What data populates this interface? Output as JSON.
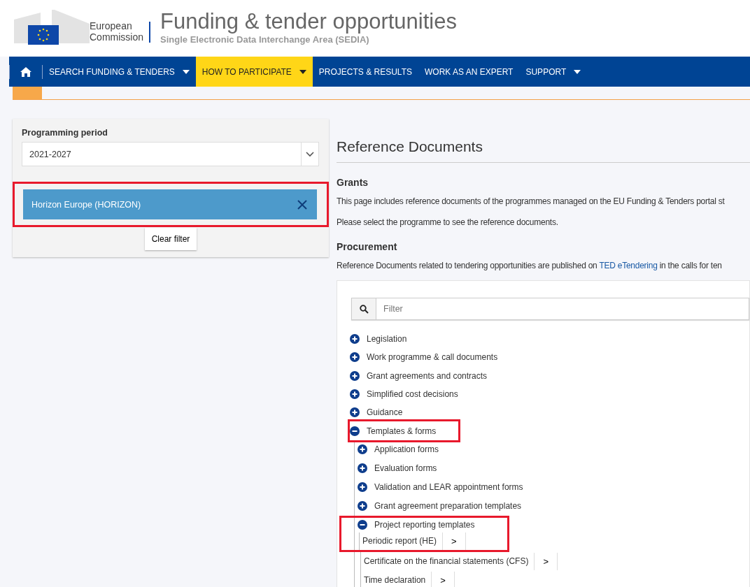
{
  "header": {
    "org_line1": "European",
    "org_line2": "Commission",
    "title": "Funding & tender opportunities",
    "subtitle": "Single Electronic Data Interchange Area (SEDIA)"
  },
  "nav": [
    {
      "label": "SEARCH FUNDING & TENDERS",
      "selected": false,
      "dropdown": true
    },
    {
      "label": "HOW TO PARTICIPATE",
      "selected": true,
      "dropdown": true
    },
    {
      "label": "PROJECTS & RESULTS",
      "selected": false,
      "dropdown": false
    },
    {
      "label": "WORK AS AN EXPERT",
      "selected": false,
      "dropdown": false
    },
    {
      "label": "SUPPORT",
      "selected": false,
      "dropdown": true
    }
  ],
  "filter_panel": {
    "label": "Programming period",
    "value": "2021-2027",
    "chip": {
      "label": "Horizon Europe (HORIZON)",
      "highlighted": true
    },
    "clear_button": "Clear filter"
  },
  "content": {
    "title": "Reference Documents",
    "sections": [
      {
        "heading": "Grants",
        "paragraphs": [
          "This page includes reference documents of the programmes managed on the EU Funding & Tenders portal st",
          "Please select the programme to see the reference documents."
        ]
      },
      {
        "heading": "Procurement",
        "link_paragraph": {
          "before": "Reference Documents related to tendering opportunities are published on",
          "link": "TED eTendering",
          "after": "in the calls for ten"
        }
      }
    ]
  },
  "tree": {
    "filter_placeholder": "Filter",
    "items": [
      {
        "label": "Legislation",
        "expanded": false,
        "highlighted": false
      },
      {
        "label": "Work programme & call documents",
        "expanded": false,
        "highlighted": false
      },
      {
        "label": "Grant agreements and contracts",
        "expanded": false,
        "highlighted": false
      },
      {
        "label": "Simplified cost decisions",
        "expanded": false,
        "highlighted": false
      },
      {
        "label": "Guidance",
        "expanded": false,
        "highlighted": false
      },
      {
        "label": "Templates & forms",
        "expanded": true,
        "highlighted": true,
        "children": [
          {
            "label": "Application forms",
            "expanded": false,
            "highlighted": false
          },
          {
            "label": "Evaluation forms",
            "expanded": false,
            "highlighted": false
          },
          {
            "label": "Validation and LEAR appointment forms",
            "expanded": false,
            "highlighted": false
          },
          {
            "label": "Grant agreement preparation templates",
            "expanded": false,
            "highlighted": false
          },
          {
            "label": "Project reporting templates",
            "expanded": true,
            "highlighted": true,
            "documents": [
              {
                "label": "Periodic report (HE)",
                "button": ">"
              },
              {
                "label": "Certificate on the financial statements (CFS)",
                "button": ">"
              },
              {
                "label": "Time declaration",
                "button": ">"
              }
            ]
          }
        ]
      }
    ]
  }
}
